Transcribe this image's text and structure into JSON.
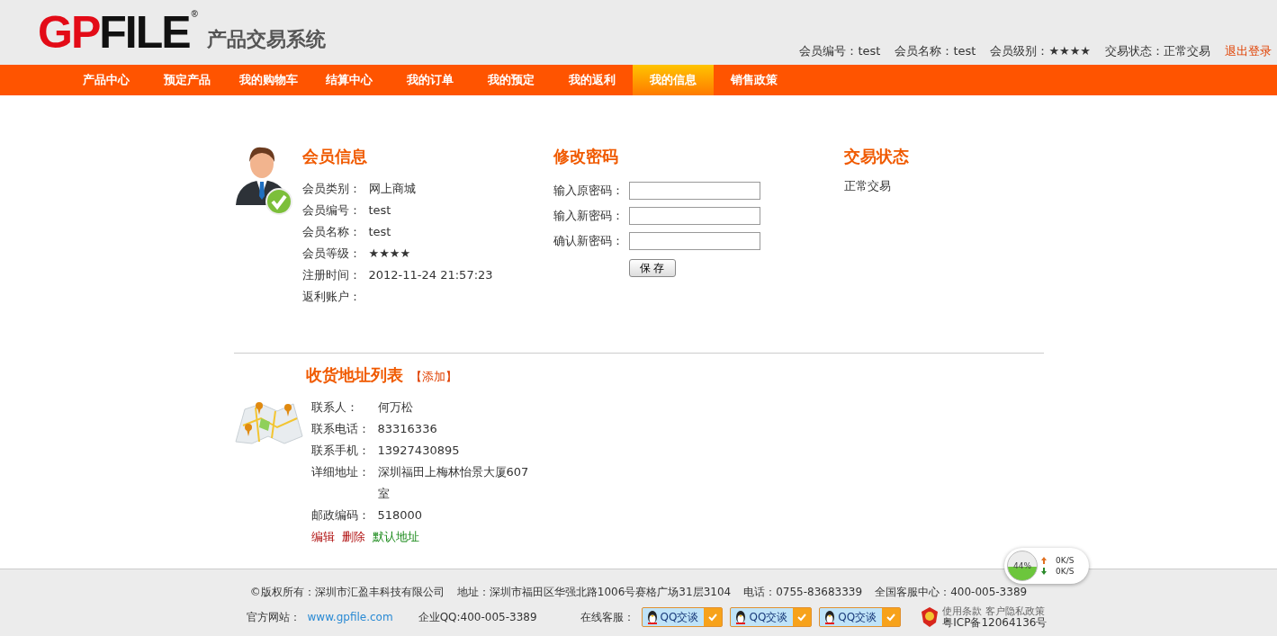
{
  "header": {
    "logo": {
      "part_1": "GP",
      "part_2": "FILE",
      "mark": "®",
      "subtitle": "产品交易系统"
    },
    "member_bar": [
      "会员编号：test",
      "会员名称：test",
      "会员级别：★★★★",
      "交易状态：正常交易"
    ],
    "logout": "退出登录"
  },
  "nav": [
    {
      "label": "产品中心",
      "selected": false
    },
    {
      "label": "预定产品",
      "selected": false
    },
    {
      "label": "我的购物车",
      "selected": false
    },
    {
      "label": "结算中心",
      "selected": false
    },
    {
      "label": "我的订单",
      "selected": false
    },
    {
      "label": "我的预定",
      "selected": false
    },
    {
      "label": "我的返利",
      "selected": false
    },
    {
      "label": "我的信息",
      "selected": true
    },
    {
      "label": "销售政策",
      "selected": false
    }
  ],
  "member_info": {
    "title": "会员信息",
    "rows": [
      {
        "label": "会员类别：",
        "value": "网上商城"
      },
      {
        "label": "会员编号：",
        "value": "test"
      },
      {
        "label": "会员名称：",
        "value": "test"
      },
      {
        "label": "会员等级：",
        "value": "★★★★"
      },
      {
        "label": "注册时间：",
        "value": "2012-11-24 21:57:23"
      },
      {
        "label": "返利账户："
      }
    ]
  },
  "password": {
    "title": "修改密码",
    "fields": [
      {
        "label": "输入原密码："
      },
      {
        "label": "输入新密码："
      },
      {
        "label": "确认新密码："
      }
    ],
    "save": "保 存"
  },
  "trade_status": {
    "title": "交易状态",
    "value": "正常交易"
  },
  "addresses": {
    "title": "收货地址列表",
    "add_link": "【添加】",
    "entries": [
      {
        "rows": [
          {
            "label": "联系人：",
            "value": "何万松"
          },
          {
            "label": "联系电话：",
            "value": "83316336"
          },
          {
            "label": "联系手机：",
            "value": "13927430895"
          },
          {
            "label": "详细地址：",
            "value": "深圳福田上梅林怡景大厦607室"
          },
          {
            "label": "邮政编码：",
            "value": "518000"
          }
        ],
        "actions": [
          {
            "label": "编辑",
            "kind": "action"
          },
          {
            "label": "删除",
            "kind": "action"
          },
          {
            "label": "默认地址",
            "kind": "default"
          }
        ]
      }
    ]
  },
  "footer": {
    "line_1": [
      "©版权所有：深圳市汇盈丰科技有限公司",
      "地址：深圳市福田区华强北路1006号赛格广场31层3104",
      "电话：0755-83683339",
      "全国客服中心：400-005-3389"
    ],
    "site_label": "官方网站：",
    "site_link": "www.gpfile.com",
    "qq": "企业QQ:400-005-3389",
    "service_label": "在线客服：",
    "chat_buttons": [
      "QQ交谈",
      "QQ交谈",
      "QQ交谈"
    ],
    "policy_links": "使用条款 客户隐私政策",
    "icp": "粤ICP备12064136号"
  },
  "speed_widget": {
    "percent": "44%",
    "upload": "0K/S",
    "download": "0K/S"
  }
}
